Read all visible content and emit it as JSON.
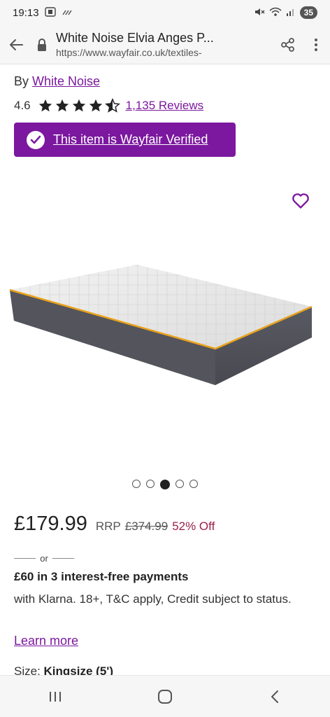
{
  "status_bar": {
    "time": "19:13",
    "battery": "35",
    "icons": [
      "screenshot-icon",
      "signal-strength-icon",
      "mute-icon",
      "wifi-icon",
      "cell-signal-icon"
    ]
  },
  "browser": {
    "page_title": "White Noise Elvia Anges P...",
    "url": "https://www.wayfair.co.uk/textiles-"
  },
  "product": {
    "brand_prefix": "By ",
    "brand": "White Noise",
    "rating": "4.6",
    "star_rating": 4.5,
    "reviews": "1,135 Reviews",
    "verified_label": "This item is Wayfair Verified",
    "carousel": {
      "total": 5,
      "active": 3
    },
    "price": "£179.99",
    "rrp_label": "RRP",
    "rrp_price": "£374.99",
    "discount": "52% Off",
    "or_text": "or",
    "klarna_title": "£60 in 3 interest-free payments",
    "klarna_text": "with Klarna. 18+, T&C apply, Credit subject to status.",
    "learn_more": "Learn more",
    "size_label": "Size: ",
    "size_value": "Kingsize (5')"
  },
  "colors": {
    "accent": "#7b189f",
    "discount": "#9c1f46",
    "mattress_trim": "#e8a21c"
  }
}
